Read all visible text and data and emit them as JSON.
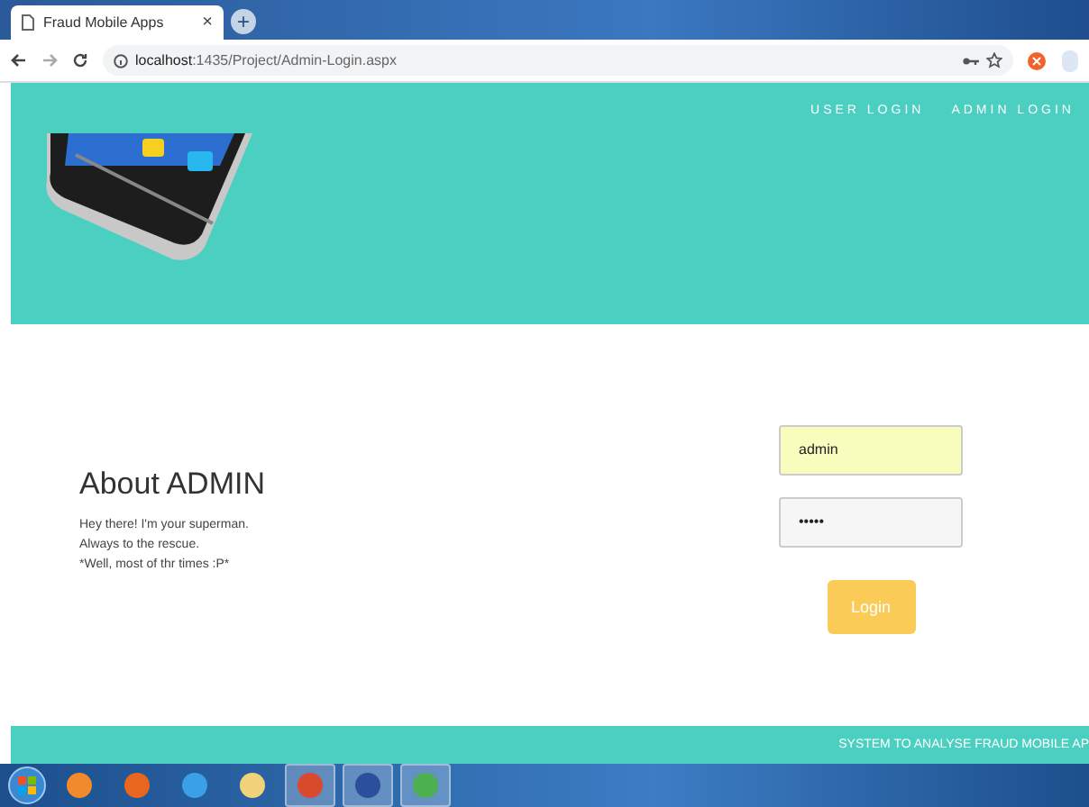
{
  "browser": {
    "tab_title": "Fraud Mobile Apps",
    "tab_close": "×",
    "new_tab": "+",
    "url_host": "localhost",
    "url_path": ":1435/Project/Admin-Login.aspx"
  },
  "header": {
    "nav": [
      {
        "label": "USER LOGIN"
      },
      {
        "label": "ADMIN LOGIN"
      }
    ]
  },
  "about": {
    "title": "About ADMIN",
    "lines": [
      "Hey there! I'm your superman.",
      "Always to the rescue.",
      "*Well, most of thr times :P*"
    ]
  },
  "login": {
    "username": "admin",
    "password": "•••••",
    "button": "Login"
  },
  "footer": {
    "text": "SYSTEM TO ANALYSE FRAUD MOBILE AP"
  },
  "taskbar": {
    "apps": [
      {
        "kind": "media",
        "pinned_open": false
      },
      {
        "kind": "firefox",
        "pinned_open": false
      },
      {
        "kind": "ie",
        "pinned_open": false
      },
      {
        "kind": "folder",
        "pinned_open": false
      },
      {
        "kind": "office",
        "pinned_open": true
      },
      {
        "kind": "loop",
        "pinned_open": true
      },
      {
        "kind": "chrome",
        "pinned_open": true
      }
    ]
  }
}
